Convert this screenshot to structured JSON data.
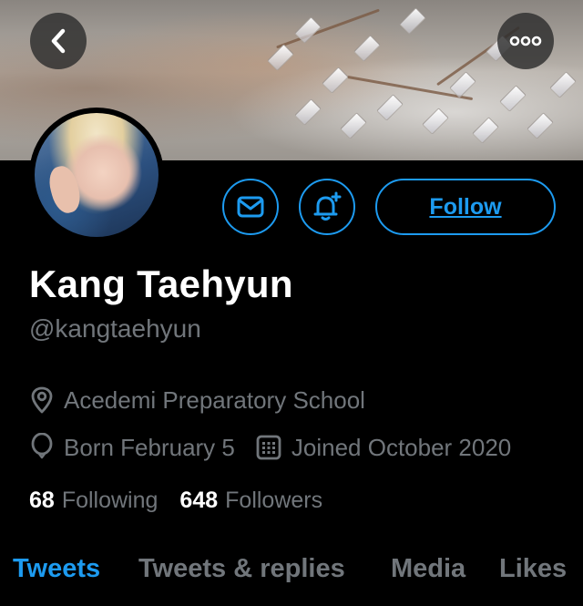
{
  "header": {
    "icons": {
      "back": "back-chevron-icon",
      "more": "more-dots-icon"
    }
  },
  "profile": {
    "name": "Kang Taehyun",
    "handle": "@kangtaehyun",
    "location": "Acedemi Preparatory School",
    "birthday": "Born February 5",
    "joined": "Joined October 2020",
    "following_count": "68",
    "following_label": "Following",
    "followers_count": "648",
    "followers_label": "Followers"
  },
  "actions": {
    "message_icon": "mail-icon",
    "notify_icon": "bell-plus-icon",
    "follow_label": "Follow"
  },
  "tabs": [
    {
      "label": "Tweets",
      "active": true
    },
    {
      "label": "Tweets & replies",
      "active": false
    },
    {
      "label": "Media",
      "active": false
    },
    {
      "label": "Likes",
      "active": false
    }
  ],
  "colors": {
    "accent": "#1d9bf0",
    "background": "#000000",
    "secondary_text": "#71767b",
    "primary_text": "#ffffff"
  }
}
